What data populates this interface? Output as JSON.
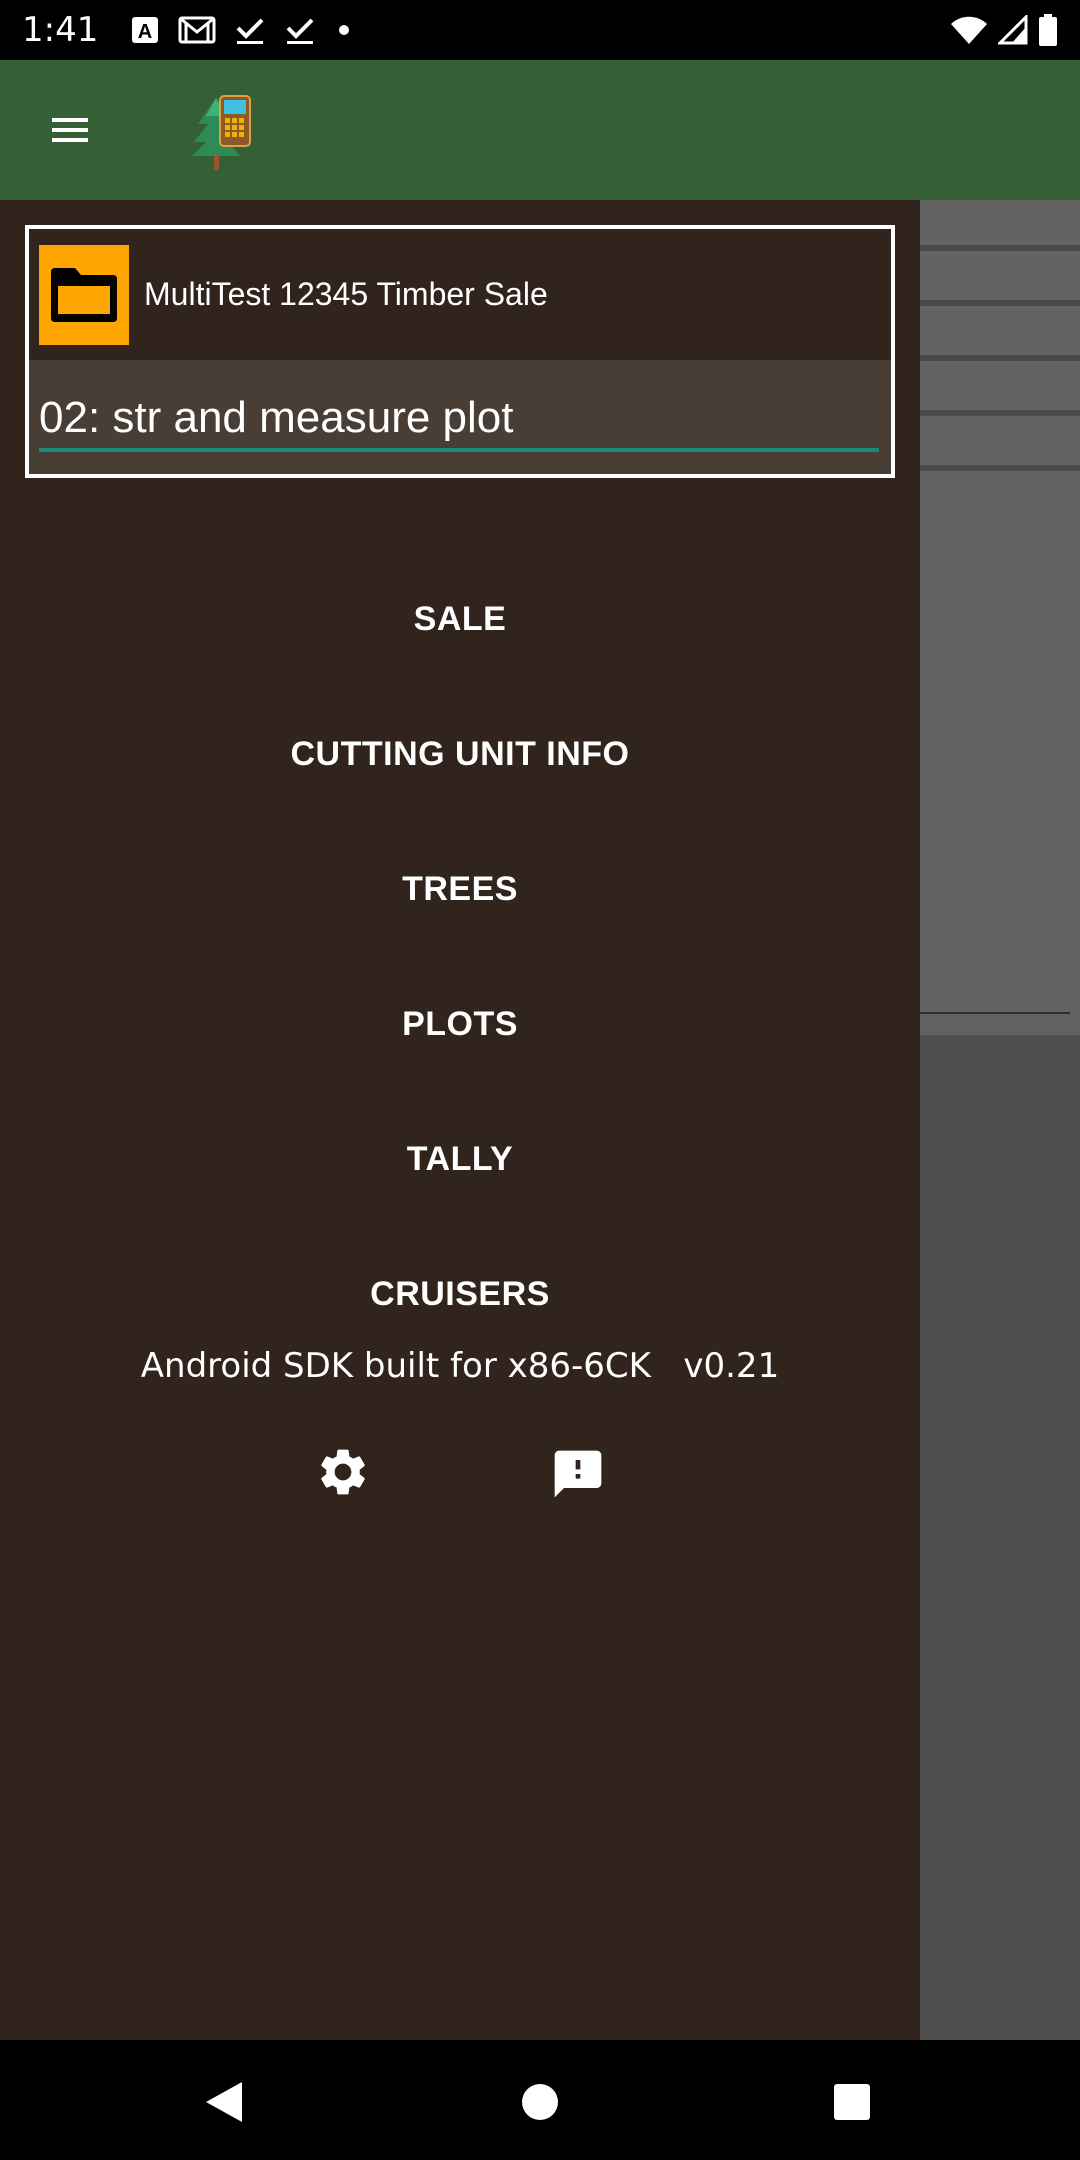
{
  "status_bar": {
    "time": "1:41",
    "left_icons": [
      "a-icon",
      "gmail-icon",
      "check-icon",
      "check-icon",
      "dot-icon"
    ],
    "right_icons": [
      "wifi-icon",
      "signal-icon",
      "battery-icon"
    ]
  },
  "app_bar": {
    "menu_icon": "hamburger-menu-icon",
    "logo_icon": "tree-calculator-logo-icon",
    "color": "#356035"
  },
  "drawer": {
    "sale_icon": "folder-icon",
    "sale_name": "MultiTest 12345 Timber Sale",
    "cutting_unit": "02: str and measure plot",
    "nav_items": [
      "SALE",
      "CUTTING UNIT INFO",
      "TREES",
      "PLOTS",
      "TALLY",
      "CRUISERS"
    ],
    "device_info": "Android SDK built for x86-6CK   v0.21",
    "settings_icon": "gear-icon",
    "feedback_icon": "feedback-icon",
    "background": "#30241c",
    "accent": "#ffa500"
  },
  "nav_bar": {
    "icons": [
      "back-icon",
      "home-icon",
      "recents-icon"
    ]
  }
}
